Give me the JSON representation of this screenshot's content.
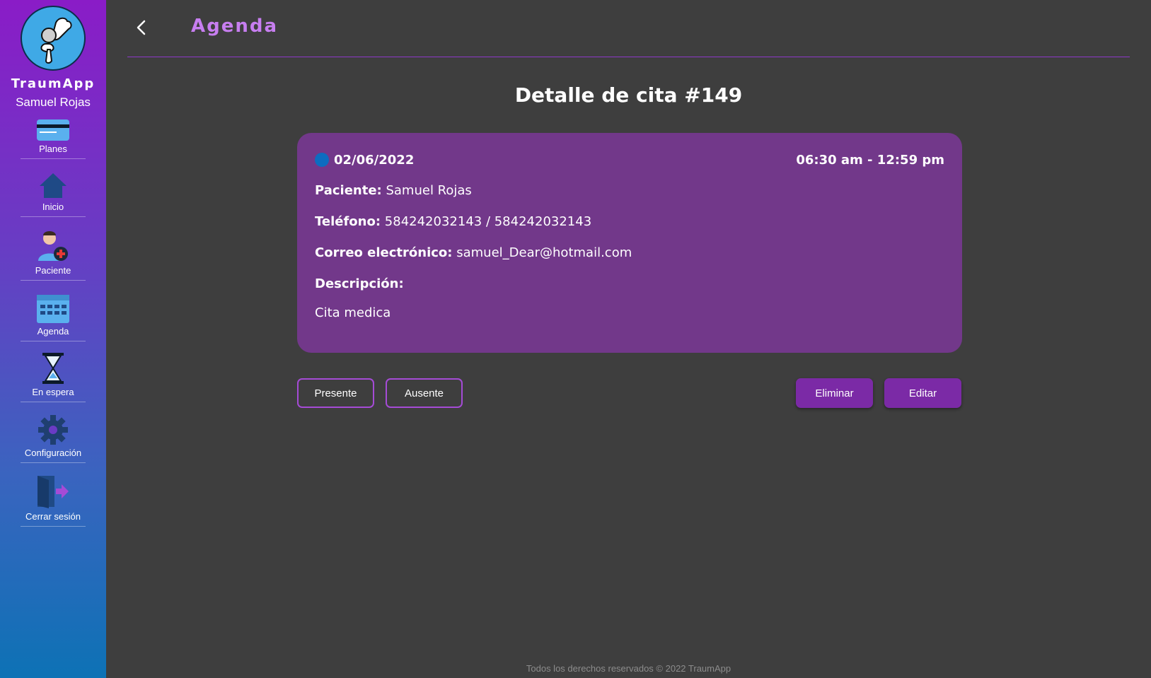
{
  "sidebar": {
    "brand": "TraumApp",
    "user_name": "Samuel Rojas",
    "items": [
      {
        "label": "Planes",
        "icon": "credit-card-icon"
      },
      {
        "label": "Inicio",
        "icon": "home-icon"
      },
      {
        "label": "Paciente",
        "icon": "add-patient-icon"
      },
      {
        "label": "Agenda",
        "icon": "calendar-icon"
      },
      {
        "label": "En espera",
        "icon": "hourglass-icon"
      },
      {
        "label": "Configuración",
        "icon": "gear-icon"
      },
      {
        "label": "Cerrar sesión",
        "icon": "logout-icon"
      }
    ]
  },
  "header": {
    "title": "Agenda"
  },
  "page": {
    "title": "Detalle de cita #149"
  },
  "appointment": {
    "date": "02/06/2022",
    "time_range": "06:30 am - 12:59 pm",
    "status_color": "#0d6cc0",
    "patient_label": "Paciente:",
    "patient_value": "Samuel Rojas",
    "phone_label": "Teléfono:",
    "phone_value": "584242032143 / 584242032143",
    "email_label": "Correo electrónico:",
    "email_value": "samuel_Dear@hotmail.com",
    "description_label": "Descripción:",
    "description_value": "Cita medica"
  },
  "actions": {
    "present": "Presente",
    "absent": "Ausente",
    "delete": "Eliminar",
    "edit": "Editar"
  },
  "footer": {
    "text": "Todos los derechos reservados © 2022 TraumApp"
  },
  "colors": {
    "accent": "#c77ef0",
    "card": "#72388a",
    "button": "#7b2aa6",
    "background": "#3e3e3e"
  }
}
